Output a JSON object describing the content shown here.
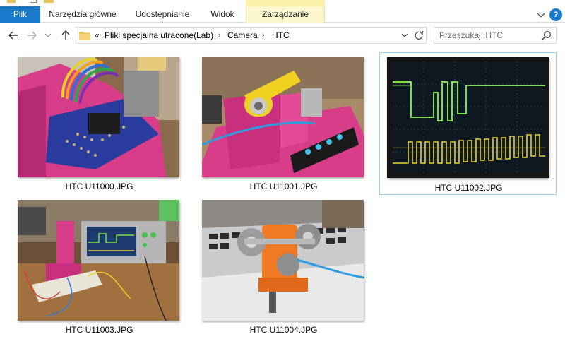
{
  "ribbon": {
    "tabs": [
      "Plik",
      "Narzędzia główne",
      "Udostępnianie",
      "Widok",
      "Zarządzanie"
    ]
  },
  "address": {
    "overflow": "«",
    "crumbs": [
      "Pliki specjalna utracone(Lab)",
      "Camera",
      "HTC"
    ],
    "separator": "›"
  },
  "search": {
    "placeholder": "Przeszukaj: HTC"
  },
  "files": [
    {
      "name": "HTC U11000.JPG",
      "selected": false
    },
    {
      "name": "HTC U11001.JPG",
      "selected": false
    },
    {
      "name": "HTC U11002.JPG",
      "selected": true
    },
    {
      "name": "HTC U11003.JPG",
      "selected": false
    },
    {
      "name": "HTC U11004.JPG",
      "selected": false
    }
  ],
  "colors": {
    "accent": "#1979ca",
    "context_tab": "#fdf7cf",
    "selection_border": "#99d1ff",
    "folder": "#e8c45a"
  }
}
